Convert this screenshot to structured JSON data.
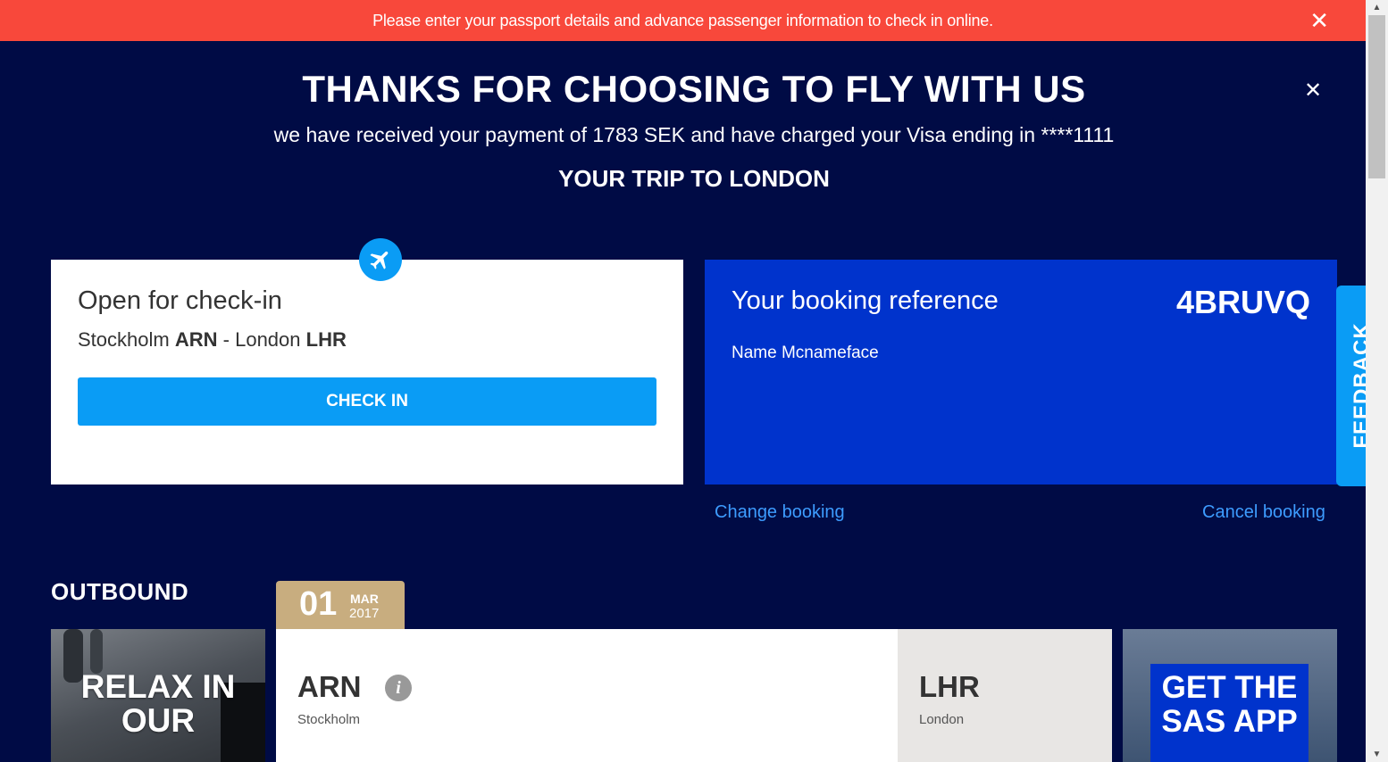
{
  "alert": {
    "message": "Please enter your passport details and advance passenger information to check in online.",
    "close_glyph": "✕"
  },
  "modal": {
    "close_glyph": "✕",
    "title": "THANKS FOR CHOOSING TO FLY WITH US",
    "payment": "we have received your payment of 1783 SEK and have charged your Visa ending in ****1111",
    "trip_title": "YOUR TRIP TO LONDON"
  },
  "checkin": {
    "icon": "airplane-icon",
    "status": "Open for check-in",
    "origin_city": "Stockholm",
    "origin_code": "ARN",
    "separator": "-",
    "dest_city": "London",
    "dest_code": "LHR",
    "button_label": "CHECK IN"
  },
  "booking": {
    "label": "Your booking reference",
    "reference": "4BRUVQ",
    "passenger": "Name Mcnameface",
    "change_link": "Change booking",
    "cancel_link": "Cancel booking"
  },
  "outbound": {
    "label": "OUTBOUND",
    "date_day": "01",
    "date_month": "MAR",
    "date_year": "2017",
    "origin_code": "ARN",
    "origin_city": "Stockholm",
    "info_icon": "i",
    "dest_code": "LHR",
    "dest_city": "London",
    "promo_left": "RELAX IN OUR",
    "promo_right": "GET THE SAS APP"
  },
  "feedback": {
    "label": "FEEDBACK"
  },
  "scrollbar": {
    "up_glyph": "▲",
    "down_glyph": "▼"
  },
  "colors": {
    "alert": "#f8483b",
    "background": "#000b45",
    "accent_blue": "#0a9cf5",
    "booking_blue": "#0033cc",
    "link": "#3d9cff",
    "date_tab": "#c8ad7f"
  }
}
